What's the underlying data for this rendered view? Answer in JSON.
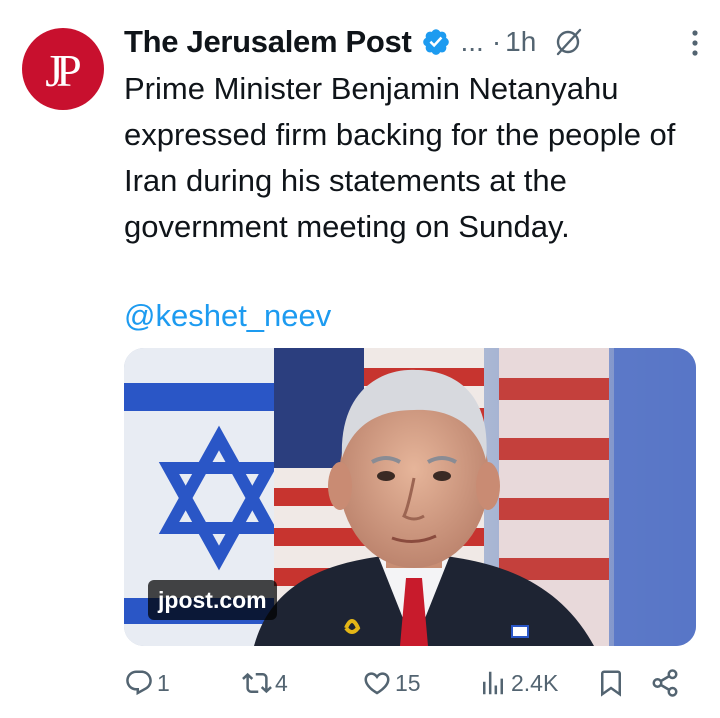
{
  "post": {
    "avatar_text": "JP",
    "author_name": "The Jerusalem Post",
    "ellipsis": "...",
    "separator": "·",
    "timestamp": "1h",
    "text": "Prime Minister Benjamin Netanyahu expressed firm backing for the people of Iran during his statements at the government meeting on Sunday.",
    "mention": "@keshet_neev",
    "media": {
      "source_label": "jpost.com"
    }
  },
  "actions": {
    "replies": "1",
    "reposts": "4",
    "likes": "15",
    "views": "2.4K"
  },
  "colors": {
    "brand_red": "#c8102e",
    "verified_blue": "#1d9bf0",
    "link_blue": "#1d9bf0",
    "muted_gray": "#536471"
  },
  "icons": [
    "verified-badge-icon",
    "grok-icon",
    "more-options-icon",
    "reply-icon",
    "repost-icon",
    "like-icon",
    "views-icon",
    "bookmark-icon",
    "share-icon"
  ]
}
